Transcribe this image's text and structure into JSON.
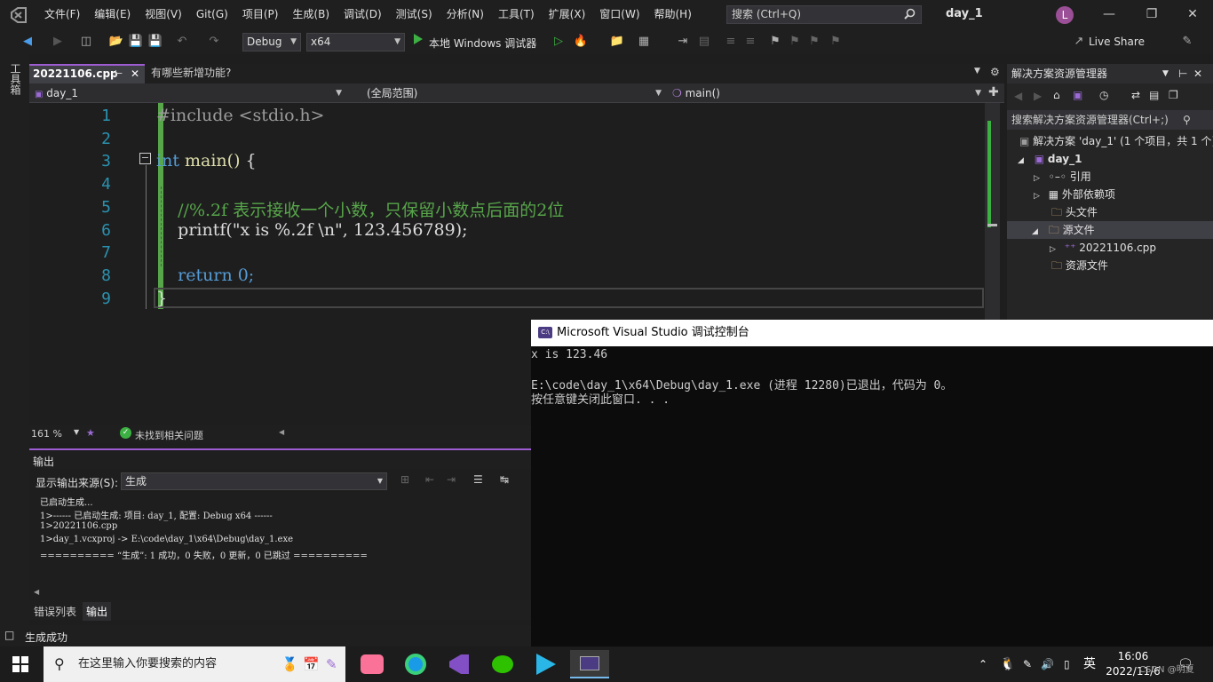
{
  "menubar": {
    "items": [
      "文件(F)",
      "编辑(E)",
      "视图(V)",
      "Git(G)",
      "项目(P)",
      "生成(B)",
      "调试(D)",
      "测试(S)",
      "分析(N)",
      "工具(T)",
      "扩展(X)",
      "窗口(W)",
      "帮助(H)"
    ],
    "search_placeholder": "搜索 (Ctrl+Q)",
    "solution_name": "day_1",
    "avatar_letter": "L"
  },
  "toolbar": {
    "config": "Debug",
    "platform": "x64",
    "run_label": "本地 Windows 调试器",
    "live_share": "Live Share"
  },
  "left_toolbox": {
    "label": "工具箱"
  },
  "doc_tabs": {
    "active": "20221106.cpp",
    "inactive": "有哪些新增功能?"
  },
  "nav_bar": {
    "project": "day_1",
    "scope": "(全局范围)",
    "member": "main()"
  },
  "editor": {
    "line_numbers": [
      "1",
      "2",
      "3",
      "4",
      "5",
      "6",
      "7",
      "8",
      "9"
    ],
    "lines": [
      "#include <stdio.h>",
      "",
      "int main() {",
      "",
      "    //%.2f 表示接收一个小数，只保留小数点后面的2位",
      "    printf(\"x is %.2f \\n\", 123.456789);",
      "",
      "    return 0;",
      "}"
    ],
    "zoom": "161 %",
    "issues": "未找到相关问题"
  },
  "output": {
    "title": "输出",
    "source_label": "显示输出来源(S):",
    "source_value": "生成",
    "lines": [
      "已启动生成...",
      "1>------ 已启动生成: 项目: day_1, 配置: Debug x64 ------",
      "1>20221106.cpp",
      "1>day_1.vcxproj -> E:\\code\\day_1\\x64\\Debug\\day_1.exe",
      "========== “生成”: 1 成功，0 失败，0 更新，0 已跳过 =========="
    ]
  },
  "bottom_tabs": [
    "错误列表",
    "输出"
  ],
  "status_bar": {
    "text": "生成成功"
  },
  "solution_explorer": {
    "title": "解决方案资源管理器",
    "search": "搜索解决方案资源管理器(Ctrl+;)",
    "items": [
      {
        "label": "解决方案 'day_1' (1 个项目，共 1 个)"
      },
      {
        "label": "day_1"
      },
      {
        "label": "引用"
      },
      {
        "label": "外部依赖项"
      },
      {
        "label": "头文件"
      },
      {
        "label": "源文件"
      },
      {
        "label": "20221106.cpp"
      },
      {
        "label": "资源文件"
      }
    ]
  },
  "console": {
    "title": "Microsoft Visual Studio 调试控制台",
    "lines": [
      "x is 123.46",
      "",
      "E:\\code\\day_1\\x64\\Debug\\day_1.exe (进程 12280)已退出，代码为 0。",
      "按任意键关闭此窗口. . ."
    ]
  },
  "taskbar": {
    "search_placeholder": "在这里输入你要搜索的内容",
    "time": "16:06",
    "date": "2022/11/6",
    "ime": "英",
    "watermark": "CSDN @明夏"
  },
  "colors": {
    "accent": "#9d5cd1",
    "green_bar": "#57a64a"
  }
}
